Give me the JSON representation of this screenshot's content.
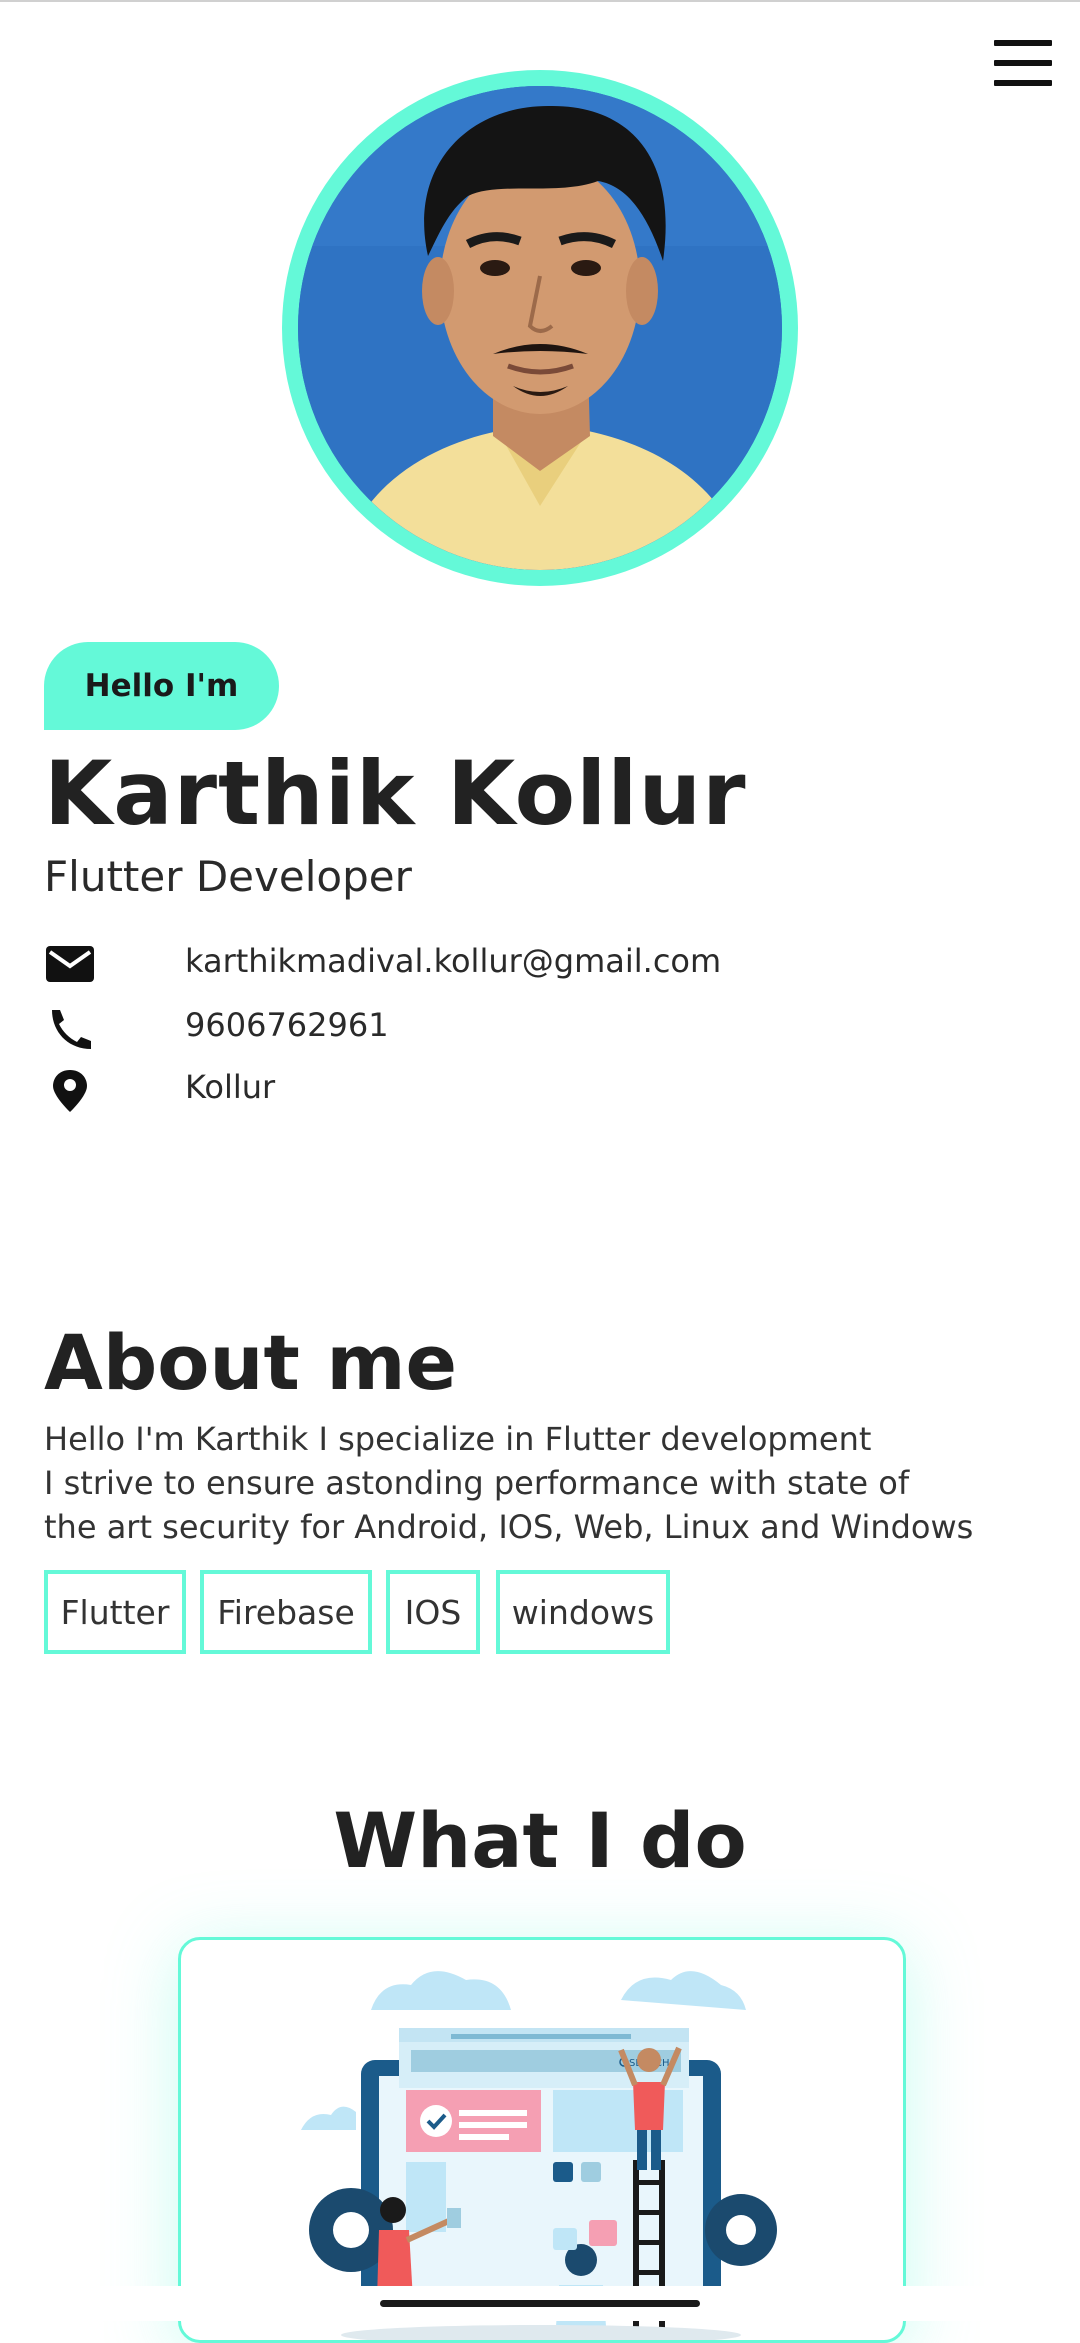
{
  "header": {
    "menu_icon": "hamburger-menu-icon"
  },
  "profile": {
    "photo_icon": "profile-photo",
    "badge": "Hello I'm",
    "name": "Karthik Kollur",
    "role": "Flutter Developer"
  },
  "contacts": [
    {
      "icon": "email-icon",
      "text": "karthikmadival.kollur@gmail.com"
    },
    {
      "icon": "phone-icon",
      "text": "9606762961"
    },
    {
      "icon": "location-pin-icon",
      "text": "Kollur"
    }
  ],
  "about": {
    "title": "About me",
    "lines": [
      "Hello I'm Karthik I specialize in Flutter development",
      "I strive to ensure astonding performance with state of",
      "the art security for Android, IOS, Web, Linux and Windows"
    ],
    "tags": [
      "Flutter",
      "Firebase",
      "IOS",
      "windows"
    ]
  },
  "services": {
    "title": "What I do",
    "illustration_search": "SEARCH"
  },
  "colors": {
    "accent": "#64f9d8",
    "text": "#222222",
    "photo_bg": "#2f73c3"
  }
}
